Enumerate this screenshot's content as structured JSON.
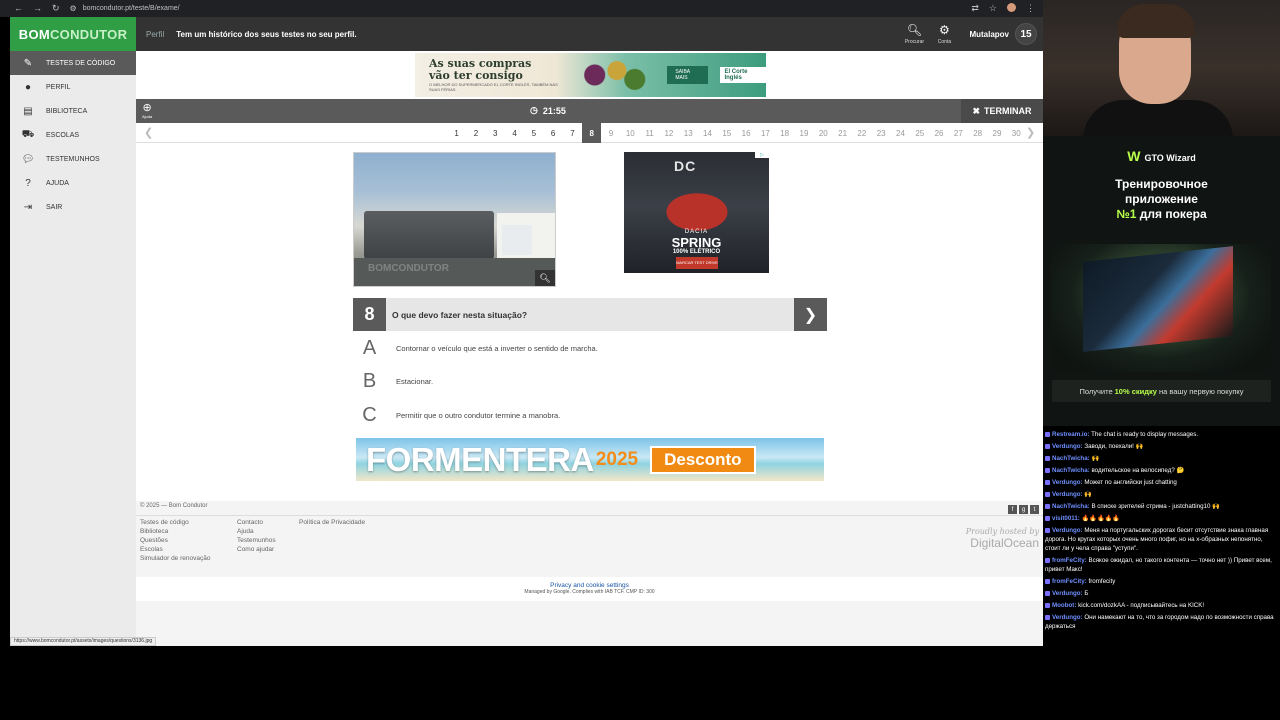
{
  "browser": {
    "url": "bomcondutor.pt/teste/B/exame/",
    "status_url": "https://www.bomcondutor.pt/assets/images/questions/3136.jpg"
  },
  "header": {
    "logo_b": "B",
    "logo_om": "OM",
    "logo_condutor": "CONDUTOR",
    "perfil": "Perfil",
    "tagline": "Tem um histórico dos seus testes no seu perfil.",
    "search_label": "Procurar",
    "account_label": "Conta",
    "username": "Mutalapov",
    "badge": "15"
  },
  "sidebar": {
    "items": [
      {
        "label": "Testes de código",
        "icon": "pencil-icon"
      },
      {
        "label": "Perfil",
        "icon": "user-icon"
      },
      {
        "label": "Biblioteca",
        "icon": "book-icon"
      },
      {
        "label": "Escolas",
        "icon": "car-icon"
      },
      {
        "label": "Testemunhos",
        "icon": "chat-icon"
      },
      {
        "label": "Ajuda",
        "icon": "help-icon"
      },
      {
        "label": "Sair",
        "icon": "logout-icon"
      }
    ]
  },
  "ad_top": {
    "headline_1": "As suas compras",
    "headline_2": "vão ter consigo",
    "subline": "O MELHOR DO SUPERMERCADO EL CORTE INGLÉS. TAMBÉM NAS SUAS FÉRIAS.",
    "cta": "SAIBA MAIS",
    "brand": "El Corte Inglés"
  },
  "toolbar": {
    "help": "Ajuda",
    "timer": "21:55",
    "finish": "TERMINAR"
  },
  "question_nav": {
    "numbers": [
      "1",
      "2",
      "3",
      "4",
      "5",
      "6",
      "7",
      "8",
      "9",
      "10",
      "11",
      "12",
      "13",
      "14",
      "15",
      "16",
      "17",
      "18",
      "19",
      "20",
      "21",
      "22",
      "23",
      "24",
      "25",
      "26",
      "27",
      "28",
      "29",
      "30"
    ],
    "current": 8
  },
  "photo": {
    "watermark": "BOMCONDUTOR"
  },
  "ad_side": {
    "brand": "DC",
    "line1": "DACIA",
    "line2": "SPRING",
    "line3": "100% ELÉTRICO",
    "cta": "MARCAR TEST DRIVE"
  },
  "question": {
    "number": "8",
    "text": "O que devo fazer nesta situação?",
    "answers": [
      {
        "letter": "A",
        "text": "Contornar o veículo que está a inverter o sentido de marcha."
      },
      {
        "letter": "B",
        "text": "Estacionar."
      },
      {
        "letter": "C",
        "text": "Permitir que o outro condutor termine a manobra."
      }
    ]
  },
  "ad_bottom": {
    "title": "FORMENTERA",
    "year": "2025",
    "cta": "Desconto"
  },
  "footer": {
    "copyright": "© 2025 — Bom Condutor",
    "col1": [
      "Testes de código",
      "Biblioteca",
      "Questões",
      "Escolas",
      "Simulador de renovação"
    ],
    "col2": [
      "Contacto",
      "Ajuda",
      "Testemunhos",
      "Como ajudar"
    ],
    "col3": [
      "Política de Privacidade"
    ],
    "hosted_by": "Proudly hosted by",
    "host": "DigitalOcean",
    "privacy_link": "Privacy and cookie settings",
    "managed": "Managed by Google. Complies with IAB TCF. CMP ID: 300"
  },
  "gto": {
    "brand": "GTO Wizard",
    "headline_1": "Тренировочное",
    "headline_2": "приложение",
    "headline_3a": "№1",
    "headline_3b": "для покера",
    "promo_pre": "Получите",
    "promo_bold": "10% скидку",
    "promo_post": "на вашу первую покупку"
  },
  "chat": [
    {
      "nick": "Restream.io:",
      "text": "The chat is ready to display messages."
    },
    {
      "nick": "Verdungo:",
      "text": "Заводи, поехали! 🙌"
    },
    {
      "nick": "NachTwicha:",
      "text": "🙌"
    },
    {
      "nick": "NachTwicha:",
      "text": "водительское на велосипед? 🤔"
    },
    {
      "nick": "Verdungo:",
      "text": "Может по английски just chatting"
    },
    {
      "nick": "Verdungo:",
      "text": "🙌"
    },
    {
      "nick": "NachTwicha:",
      "text": "В списке зрителей стрима - justchatting10 🙌"
    },
    {
      "nick": "visit0011:",
      "text": "🔥🔥🔥🔥🔥"
    },
    {
      "nick": "Verdungo:",
      "text": "Меня на португальских дорогах бесит отсутствие знака главная дорога. Но кругах которых очень много пофиг, но на х-образных непонятно, стоит ли у чела справа \"уступи\"."
    },
    {
      "nick": "fromFeCity:",
      "text": "Всякое ожидал, но такого контента — точно нет )) Привет всем, привет Макс!"
    },
    {
      "nick": "fromFeCity:",
      "text": "fromfecity"
    },
    {
      "nick": "Verdungo:",
      "text": "Б"
    },
    {
      "nick": "Moobot:",
      "text": "kick.com/dozkAA - подписывайтесь на KICK!"
    },
    {
      "nick": "Verdungo:",
      "text": "Они намекают на то, что за городом надо по возможности справа держаться"
    }
  ]
}
